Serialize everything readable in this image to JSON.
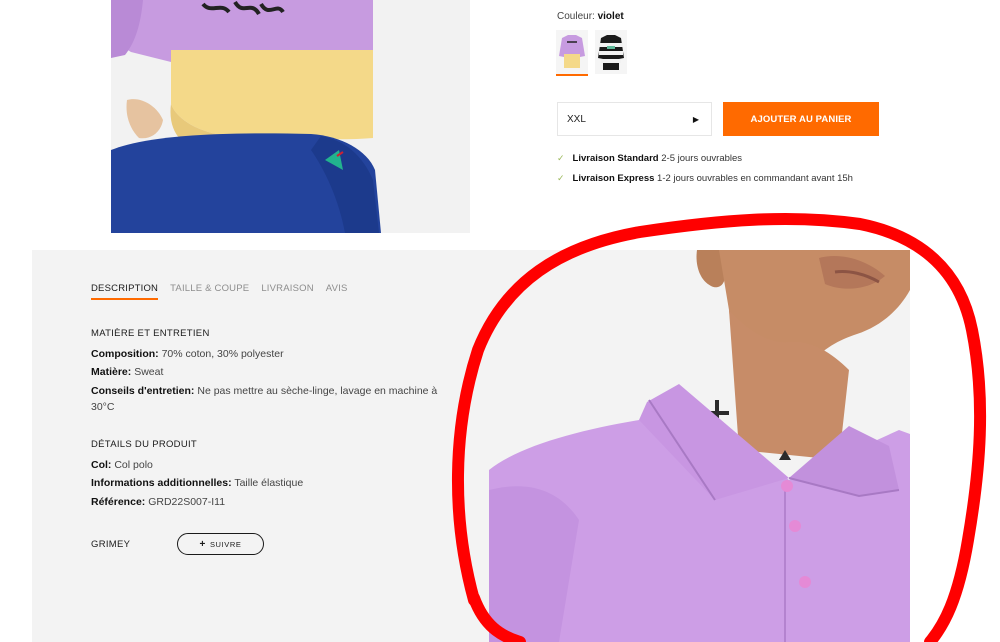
{
  "product": {
    "color_label": "Couleur:",
    "color_value": "violet",
    "swatches": [
      {
        "name": "violet",
        "selected": true
      },
      {
        "name": "rayé",
        "selected": false
      }
    ],
    "size_value": "XXL",
    "add_to_cart_label": "AJOUTER AU PANIER",
    "shipping": [
      {
        "title": "Livraison Standard",
        "detail": "2-5 jours ouvrables"
      },
      {
        "title": "Livraison Express",
        "detail": "1-2 jours ouvrables en commandant avant 15h"
      }
    ]
  },
  "tabs": [
    {
      "label": "DESCRIPTION",
      "active": true
    },
    {
      "label": "TAILLE & COUPE",
      "active": false
    },
    {
      "label": "LIVRAISON",
      "active": false
    },
    {
      "label": "AVIS",
      "active": false
    }
  ],
  "description": {
    "material_title": "MATIÈRE ET ENTRETIEN",
    "material": [
      {
        "key": "Composition:",
        "value": "70% coton, 30% polyester"
      },
      {
        "key": "Matière:",
        "value": "Sweat"
      },
      {
        "key": "Conseils d'entretien:",
        "value": "Ne pas mettre au sèche-linge, lavage en machine à 30°C"
      }
    ],
    "details_title": "DÉTAILS DU PRODUIT",
    "details": [
      {
        "key": "Col:",
        "value": "Col polo"
      },
      {
        "key": "Informations additionnelles:",
        "value": "Taille élastique"
      },
      {
        "key": "Référence:",
        "value": "GRD22S007-I11"
      }
    ]
  },
  "brand": {
    "name": "GRIMEY",
    "follow_label": "SUIVRE"
  },
  "colors": {
    "accent": "#ff6a00",
    "annotation": "#ff0000",
    "polo": "#cfa0e6",
    "panel": "#f3f3f3"
  }
}
